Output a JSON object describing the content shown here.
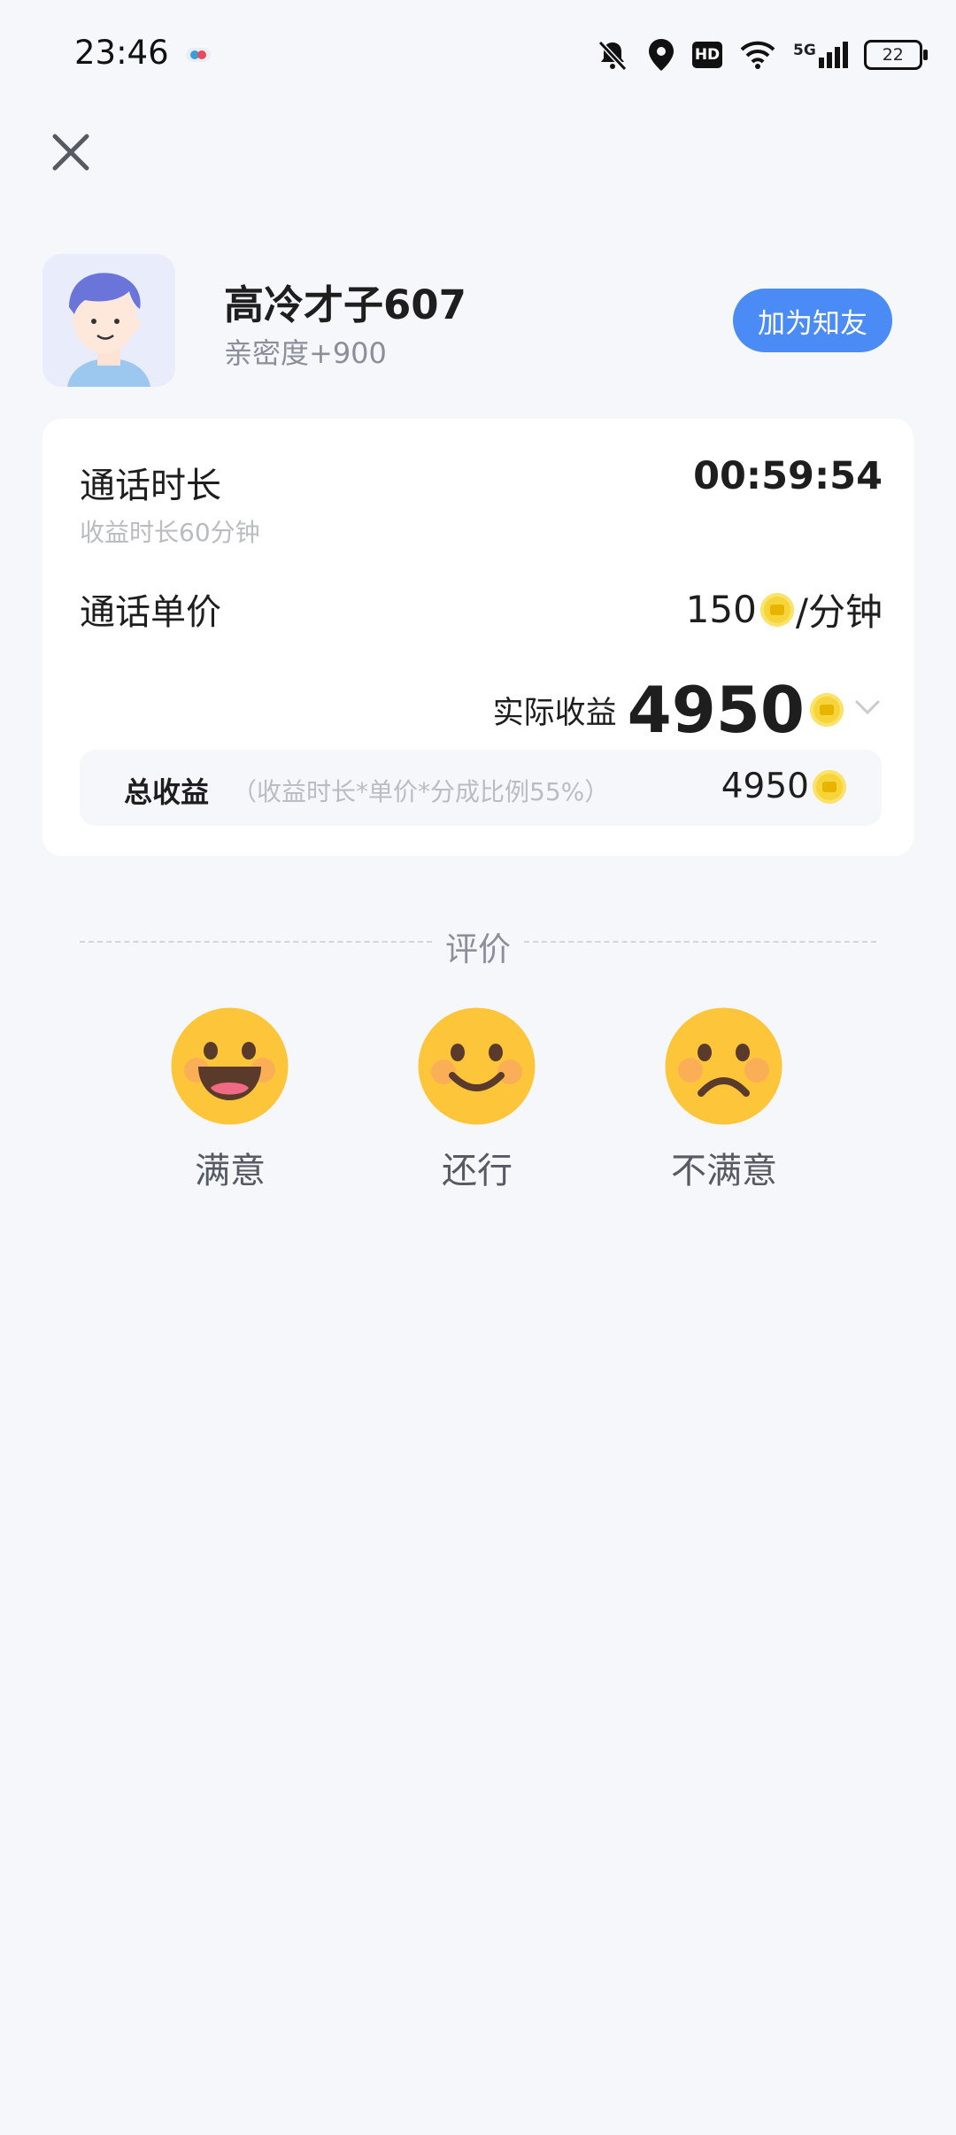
{
  "status_bar": {
    "time": "23:46",
    "network": "5G",
    "hd": "HD",
    "battery": "22"
  },
  "user": {
    "name": "高冷才子607",
    "intimacy": "亲密度+900",
    "add_button": "加为知友"
  },
  "call": {
    "duration_label": "通话时长",
    "duration_value": "00:59:54",
    "paid_duration": "收益时长60分钟",
    "price_label": "通话单价",
    "price_value": "150",
    "price_unit": "/分钟",
    "actual_label": "实际收益",
    "actual_value": "4950",
    "total_label": "总收益",
    "total_note": "（收益时长*单价*分成比例55%）",
    "total_value": "4950"
  },
  "rating": {
    "title": "评价",
    "options": [
      {
        "label": "满意",
        "icon": "grinning-face-icon"
      },
      {
        "label": "还行",
        "icon": "smiling-face-icon"
      },
      {
        "label": "不满意",
        "icon": "frowning-face-icon"
      }
    ]
  },
  "colors": {
    "accent": "#4a8bf5",
    "background": "#f5f7fa",
    "coin": "#f7d43a",
    "emoji": "#fcc53a"
  }
}
